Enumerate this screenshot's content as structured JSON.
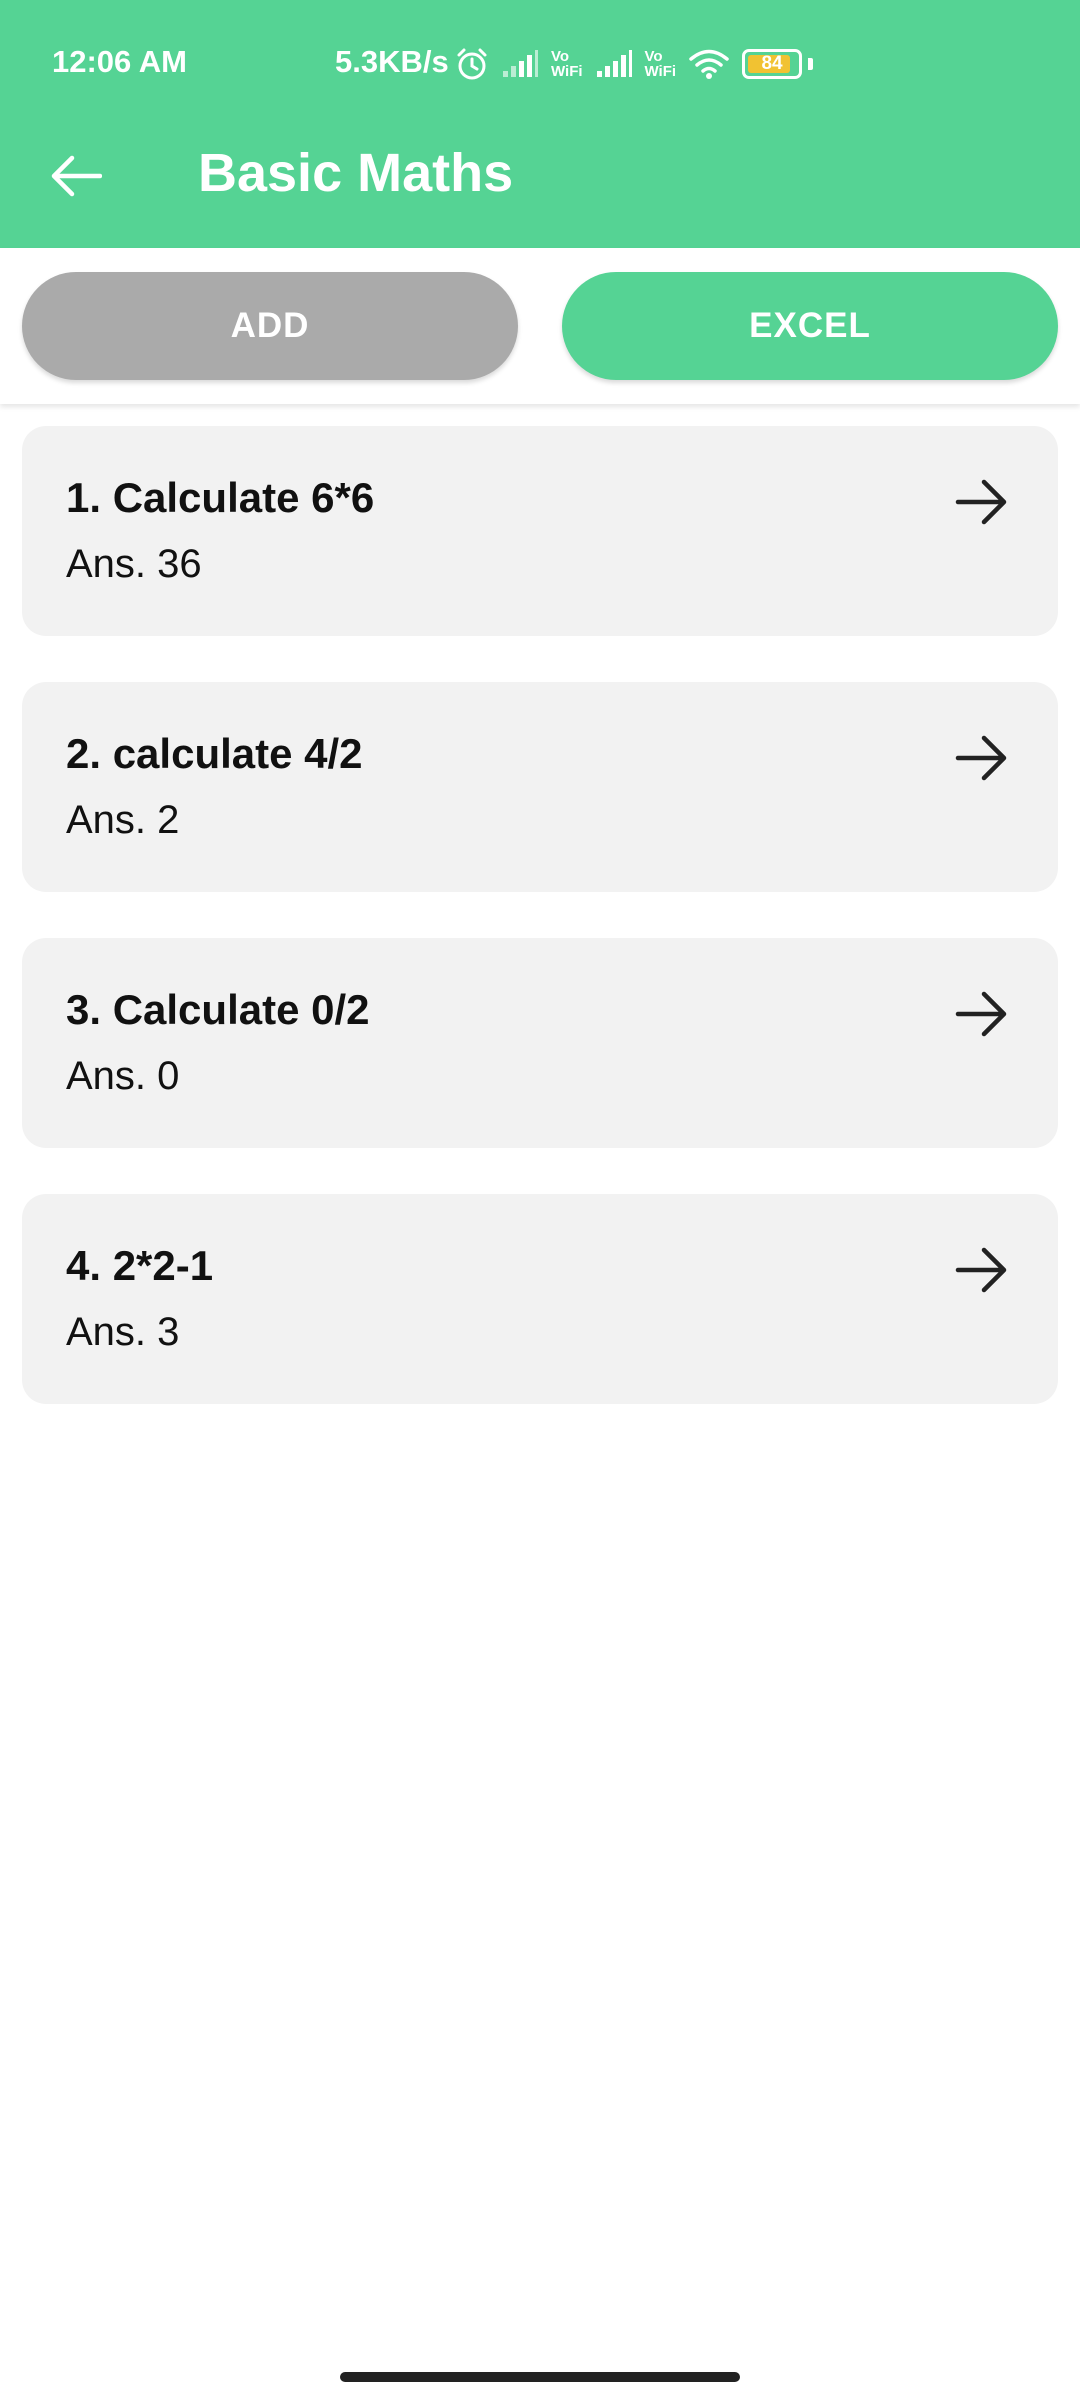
{
  "status_bar": {
    "time": "12:06 AM",
    "speed": "5.3KB/s",
    "vowifi_top": "Vo",
    "vowifi_bottom": "WiFi",
    "battery": "84",
    "icons": [
      "alarm-icon",
      "signal-icon",
      "vowifi-icon",
      "signal-icon",
      "vowifi-icon",
      "wifi-icon",
      "battery-icon"
    ]
  },
  "app_bar": {
    "title": "Basic Maths",
    "back_icon": "arrow-left-icon"
  },
  "actions": {
    "add_label": "ADD",
    "excel_label": "EXCEL"
  },
  "questions": [
    {
      "question": "1. Calculate 6*6",
      "answer": "Ans. 36"
    },
    {
      "question": "2. calculate 4/2",
      "answer": "Ans. 2"
    },
    {
      "question": "3. Calculate 0/2",
      "answer": "Ans. 0"
    },
    {
      "question": "4. 2*2-1",
      "answer": "Ans. 3"
    }
  ],
  "colors": {
    "primary": "#55d394",
    "add_button": "#aaaaaa",
    "card_background": "#f2f2f2",
    "battery_fill": "#f1c232"
  }
}
